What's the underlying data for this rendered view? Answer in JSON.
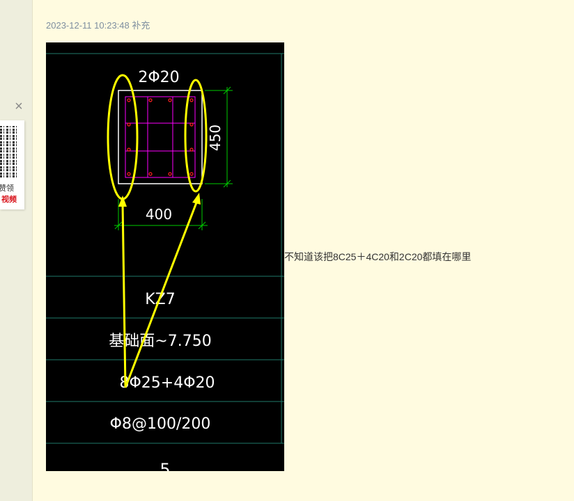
{
  "post": {
    "timestamp": "2023-12-11 10:23:48 补充",
    "comment": "不知道该把8C25＋4C20和2C20都填在哪里"
  },
  "ad": {
    "close_icon": "×",
    "line1": "赞领",
    "line2": "视频"
  },
  "drawing": {
    "top_rebar_label": "2Φ20",
    "height_dim": "450",
    "width_dim": "400",
    "column_id": "KZ7",
    "elevation_range": "基础面~7.750",
    "main_rebar": "8Φ25+4Φ20",
    "stirrup": "Φ8@100/200",
    "bottom_fragment": "5"
  },
  "colors": {
    "background": "#fffbe0",
    "cad_bg": "#000000",
    "highlight": "#ffff00",
    "dimension": "#00cc00",
    "stirrup": "#ff00ff",
    "rebar": "#ff2020",
    "grid": "#1f7a6a"
  }
}
